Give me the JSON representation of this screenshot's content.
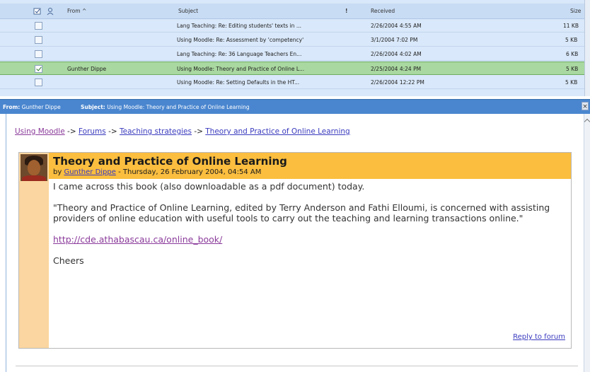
{
  "list": {
    "columns": {
      "from": "From ^",
      "subject": "Subject",
      "flag": "!",
      "received": "Received",
      "size": "Size"
    },
    "rows": [
      {
        "checked": false,
        "from": "",
        "subject": "Lang Teaching: Re: Editing students' texts in ...",
        "received": "2/26/2004 4:55 AM",
        "size": "11 KB"
      },
      {
        "checked": false,
        "from": "",
        "subject": "Using Moodle: Re: Assessment by 'competency'",
        "received": "3/1/2004 7:02 PM",
        "size": "5 KB"
      },
      {
        "checked": false,
        "from": "",
        "subject": "Lang Teaching: Re: 36 Language Teachers En...",
        "received": "2/26/2004 4:02 AM",
        "size": "6 KB"
      },
      {
        "checked": true,
        "from": "Gunther Dippe",
        "subject": "Using Moodle: Theory and Practice of Online L...",
        "received": "2/25/2004 4:24 PM",
        "size": "5 KB"
      },
      {
        "checked": false,
        "from": "",
        "subject": "Using Moodle: Re: Setting Defaults in the HT...",
        "received": "2/26/2004 12:22 PM",
        "size": "5 KB"
      }
    ]
  },
  "preview_bar": {
    "from_label": "From:",
    "from_value": "Gunther Dippe",
    "subject_label": "Subject:",
    "subject_value": "Using Moodle: Theory and Practice of Online Learning",
    "close": "×"
  },
  "breadcrumb": {
    "items": [
      "Using Moodle",
      "Forums",
      "Teaching strategies",
      "Theory and Practice of Online Learning"
    ],
    "separator": "->"
  },
  "post": {
    "title": "Theory and Practice of Online Learning",
    "by_prefix": "by",
    "author": "Gunther Dippe",
    "date": "- Thursday, 26 February 2004, 04:54 AM",
    "paragraphs": [
      "I came across this book (also downloadable as a pdf document) today.",
      "\"Theory and Practice of Online Learning, edited by Terry Anderson and Fathi Elloumi, is concerned with assisting providers of online education with useful tools to carry out the teaching and learning transactions online.\""
    ],
    "link": "http://cde.athabascau.ca/online_book/",
    "signoff": "Cheers",
    "reply": "Reply to forum"
  },
  "colors": {
    "list_bg": "#d9e8fa",
    "selected_row": "#a9d8a0",
    "preview_bar": "#4a86cf",
    "post_header": "#fbbe3f",
    "post_side": "#fbd6a0",
    "link": "#3a3abf",
    "visited": "#8a3a9a"
  }
}
